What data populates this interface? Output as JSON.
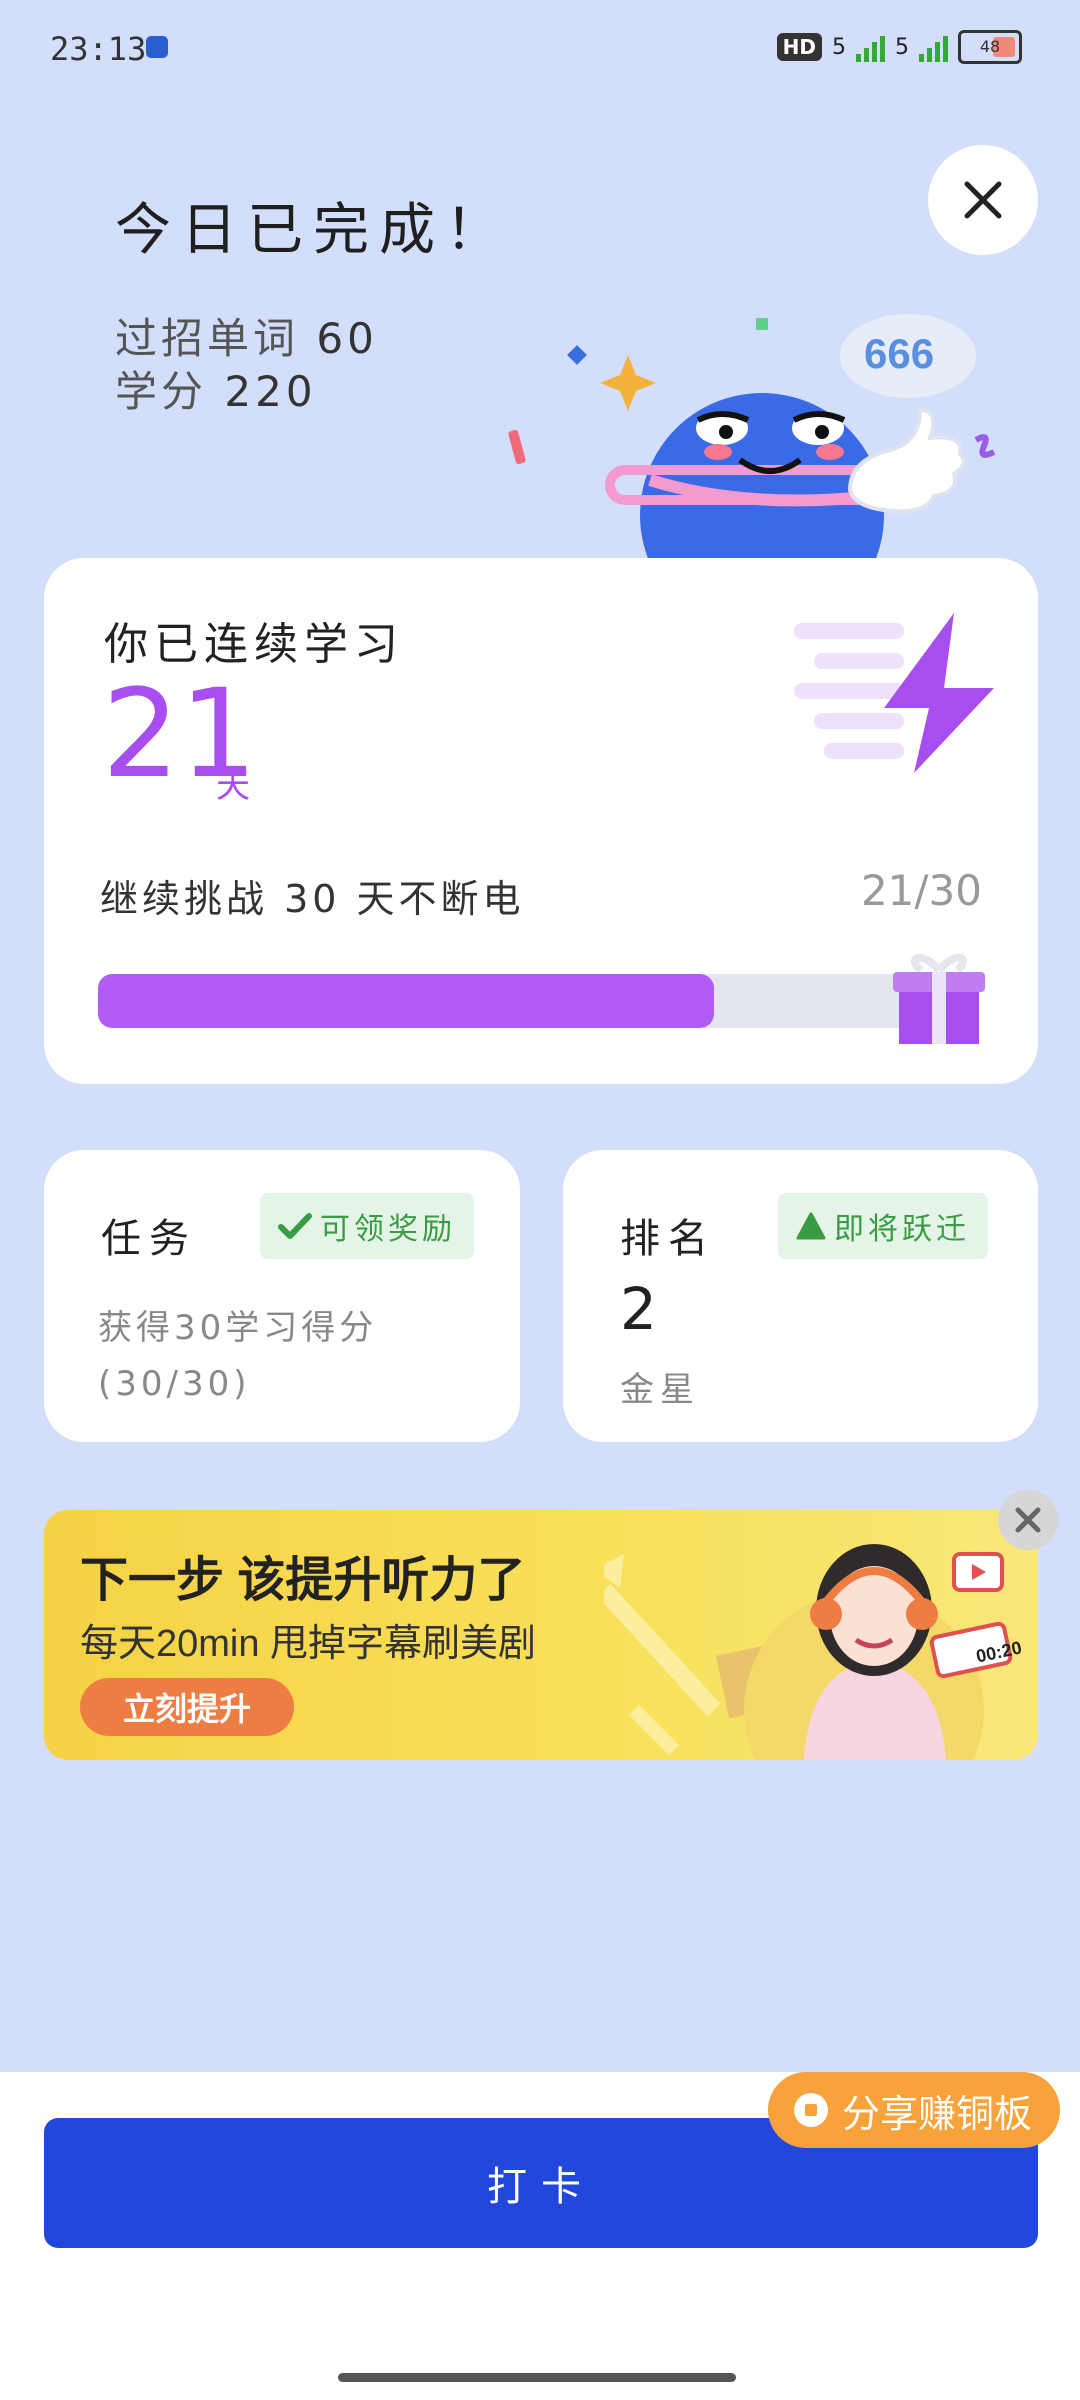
{
  "status_bar": {
    "time": "23:13",
    "hd_label": "HD",
    "network_1": "5",
    "network_2": "5",
    "battery_level": "48",
    "icons": [
      "app-notification-icon",
      "volte-icon",
      "signal-icon",
      "battery-icon"
    ]
  },
  "header": {
    "title": "今日已完成！",
    "words_label": "过招单词",
    "words_value": "60",
    "credits_label": "学分",
    "credits_value": "220",
    "close_icon": "close-icon"
  },
  "mascot": {
    "speech_text": "666"
  },
  "streak_card": {
    "label": "你已连续学习",
    "days": "21",
    "unit": "天",
    "challenge_text": "继续挑战 30 天不断电",
    "challenge_progress": "21/30",
    "progress_value": 21,
    "progress_max": 30,
    "icon": "lightning-icon",
    "reward_icon": "gift-icon"
  },
  "task_card": {
    "title": "任务",
    "badge": "可领奖励",
    "badge_icon": "check-icon",
    "desc_line1": "获得30学习得分",
    "desc_line2": "(30/30)"
  },
  "rank_card": {
    "title": "排名",
    "badge": "即将跃迁",
    "badge_icon": "triangle-up-icon",
    "rank": "2",
    "tier": "金星"
  },
  "banner": {
    "title": "下一步 该提升听力了",
    "subtitle": "每天20min 甩掉字幕刷美剧",
    "button": "立刻提升",
    "timer_text": "00:20"
  },
  "bottom": {
    "checkin_button": "打卡",
    "share_button": "分享赚铜板"
  },
  "colors": {
    "background": "#d2defa",
    "accent_purple": "#b35cf5",
    "primary_blue": "#2147dc",
    "share_orange": "#f7a23a",
    "banner_yellow": "#f6d244",
    "badge_green": "#3a9b45"
  }
}
